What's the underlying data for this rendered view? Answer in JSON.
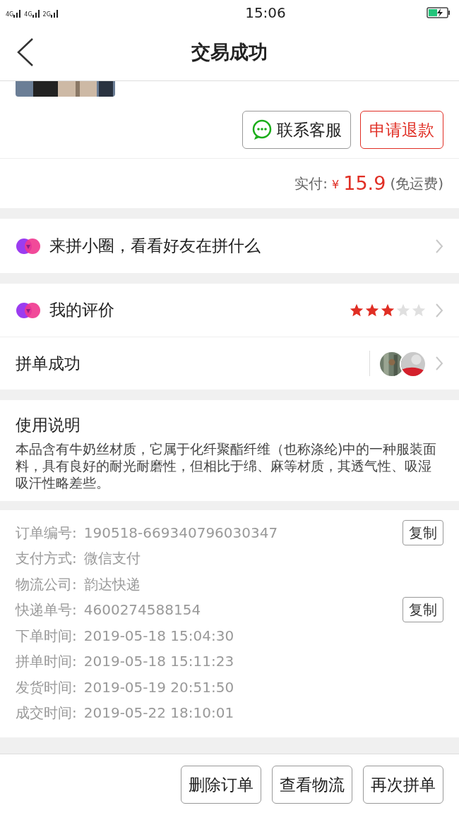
{
  "status_bar": {
    "signal_labels": [
      "4G",
      "4G",
      "2G"
    ],
    "time": "15:06"
  },
  "header": {
    "title": "交易成功"
  },
  "order_actions": [
    {
      "label": "联系客服",
      "kind": "service"
    },
    {
      "label": "申请退款",
      "kind": "primary"
    }
  ],
  "payment": {
    "label": "实付:",
    "currency": "¥",
    "amount": "15.9",
    "note": "(免运费)"
  },
  "circle_link": {
    "label": "来拼小圈，看看好友在拼什么"
  },
  "review": {
    "label": "我的评价",
    "stars": 3
  },
  "group": {
    "label": "拼单成功"
  },
  "instructions": {
    "title": "使用说明",
    "text": "本品含有牛奶丝材质，它属于化纤聚酯纤维（也称涤纶)中的一种服装面料，具有良好的耐光耐磨性，但相比于绵、麻等材质，其透气性、吸湿吸汗性略差些。"
  },
  "order_info": [
    {
      "label": "订单编号:",
      "value": "190518-669340796030347",
      "action": "复制"
    },
    {
      "label": "支付方式:",
      "value": "微信支付"
    },
    {
      "label": "物流公司:",
      "value": "韵达快递"
    },
    {
      "label": "快递单号:",
      "value": "4600274588154",
      "action": "复制"
    },
    {
      "label": "下单时间:",
      "value": "2019-05-18 15:04:30"
    },
    {
      "label": "拼单时间:",
      "value": "2019-05-18 15:11:23"
    },
    {
      "label": "发货时间:",
      "value": "2019-05-19 20:51:50"
    },
    {
      "label": "成交时间:",
      "value": "2019-05-22 18:10:01"
    }
  ],
  "bottom_buttons": [
    "删除订单",
    "查看物流",
    "再次拼单"
  ]
}
